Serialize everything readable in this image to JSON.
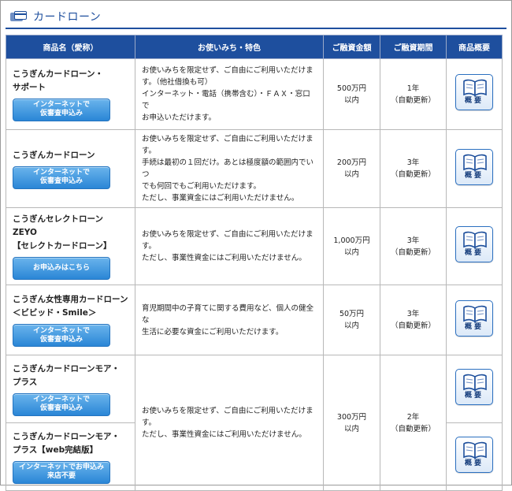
{
  "header": {
    "title": "カードローン"
  },
  "table": {
    "columns": [
      "商品名（愛称）",
      "お使いみち・特色",
      "ご融資金額",
      "ご融資期間",
      "商品概要"
    ],
    "rows": [
      {
        "name_lines": [
          "こうぎんカードローン・",
          "サポート"
        ],
        "button_lines": [
          "インターネットで",
          "仮審査申込み"
        ],
        "features": [
          "お使いみちを限定せず、ご自由にご利用いただけま",
          "す。（他社借換も可）",
          "インターネット・電話（携帯含む）・ＦＡＸ・窓口で",
          "お申込いただけます。"
        ],
        "amount_lines": [
          "500万円",
          "以内"
        ],
        "term_lines": [
          "1年",
          "（自動更新）"
        ],
        "overview_label": "概要"
      },
      {
        "name_lines": [
          "こうぎんカードローン"
        ],
        "button_lines": [
          "インターネットで",
          "仮審査申込み"
        ],
        "features": [
          "お使いみちを限定せず、ご自由にご利用いただけま",
          "す。",
          "手続は最初の１回だけ。あとは極度額の範囲内でいつ",
          "でも何回でもご利用いただけます。",
          "ただし、事業資金にはご利用いただけません。"
        ],
        "amount_lines": [
          "200万円",
          "以内"
        ],
        "term_lines": [
          "3年",
          "（自動更新）"
        ],
        "overview_label": "概要"
      },
      {
        "name_lines": [
          "こうぎんセレクトローン ZEYO",
          "【セレクトカードローン】"
        ],
        "button_lines": [
          "お申込みはこちら"
        ],
        "features": [
          "お使いみちを限定せず、ご自由にご利用いただけま",
          "す。",
          "ただし、事業性資金にはご利用いただけません。"
        ],
        "amount_lines": [
          "1,000万円",
          "以内"
        ],
        "term_lines": [
          "3年",
          "（自動更新）"
        ],
        "overview_label": "概要"
      },
      {
        "name_lines": [
          "こうぎん女性専用カードローン",
          "＜ビビッド・Smile＞"
        ],
        "button_lines": [
          "インターネットで",
          "仮審査申込み"
        ],
        "features": [
          "育児期間中の子育てに関する費用など、個人の健全な",
          "生活に必要な資金にご利用いただけます。"
        ],
        "amount_lines": [
          "50万円",
          "以内"
        ],
        "term_lines": [
          "3年",
          "（自動更新）"
        ],
        "overview_label": "概要"
      },
      {
        "name_lines": [
          "こうぎんカードローンモア・",
          "プラス"
        ],
        "button_lines": [
          "インターネットで",
          "仮審査申込み"
        ],
        "overview_label": "概要"
      },
      {
        "name_lines": [
          "こうぎんカードローンモア・",
          "プラス【web完結版】"
        ],
        "button_lines": [
          "インターネットでお申込み",
          "来店不要"
        ],
        "overview_label": "概要"
      }
    ],
    "more_plus_shared": {
      "features": [
        "お使いみちを限定せず、ご自由にご利用いただけま",
        "す。",
        "ただし、事業性資金にはご利用いただけません。"
      ],
      "amount_lines": [
        "300万円",
        "以内"
      ],
      "term_lines": [
        "2年",
        "（自動更新）"
      ]
    }
  }
}
